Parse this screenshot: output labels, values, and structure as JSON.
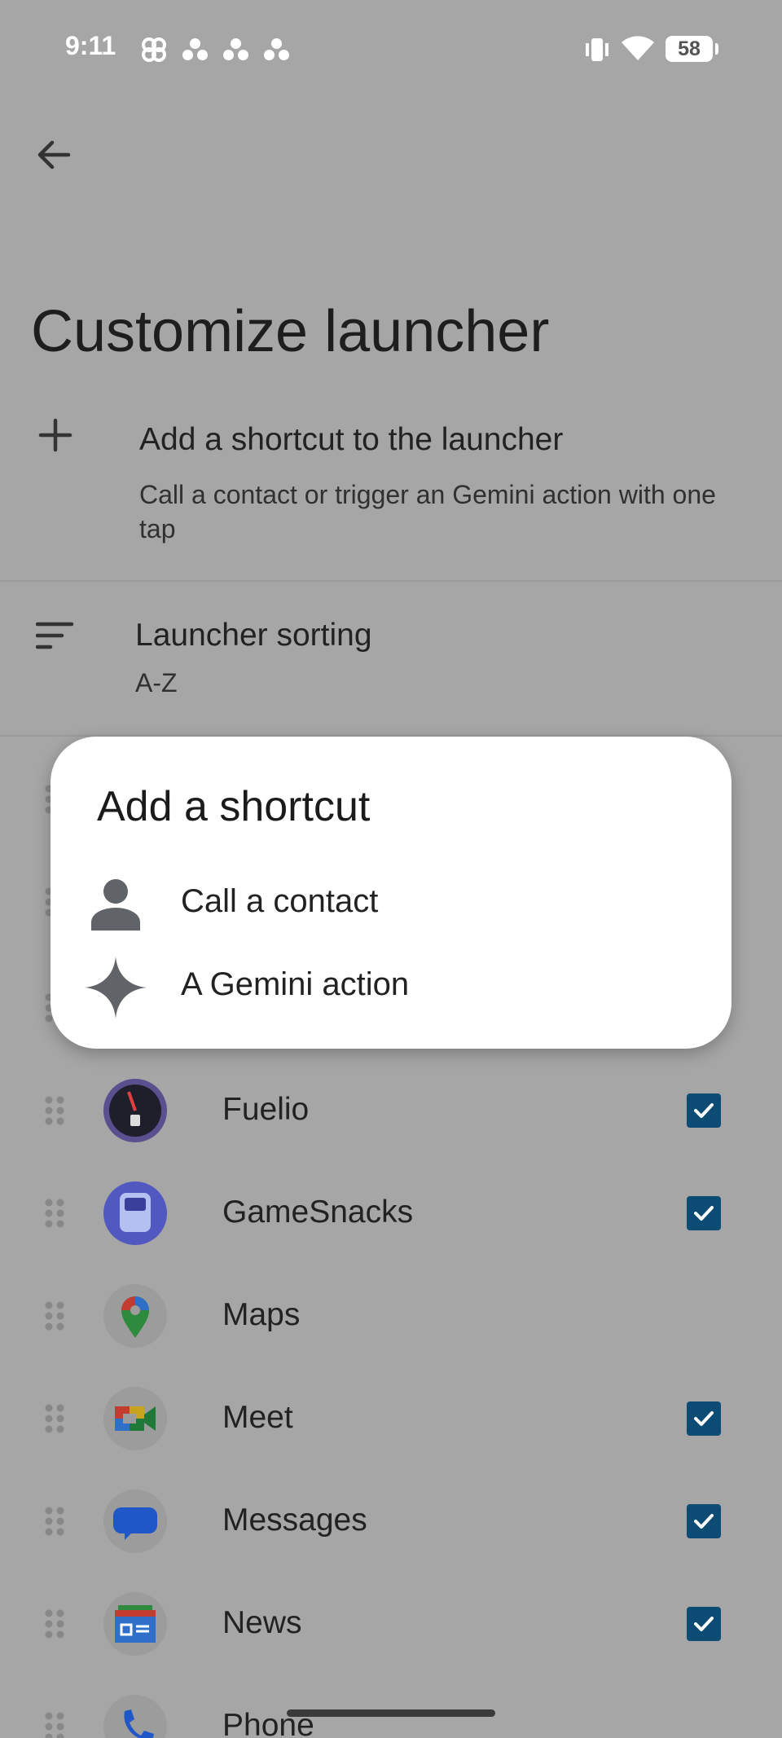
{
  "status_bar": {
    "time": "9:11",
    "battery": "58"
  },
  "page": {
    "title": "Customize launcher",
    "add_shortcut": {
      "title": "Add a shortcut to the launcher",
      "subtitle": "Call a contact or trigger an Gemini action with one tap"
    },
    "sorting": {
      "title": "Launcher sorting",
      "value": "A-Z"
    }
  },
  "apps": [
    {
      "name": "Fuelio",
      "checked": true
    },
    {
      "name": "GameSnacks",
      "checked": true
    },
    {
      "name": "Maps",
      "checked": false
    },
    {
      "name": "Meet",
      "checked": true
    },
    {
      "name": "Messages",
      "checked": true
    },
    {
      "name": "News",
      "checked": true
    },
    {
      "name": "Phone",
      "checked": false
    }
  ],
  "dialog": {
    "title": "Add a shortcut",
    "items": [
      {
        "label": "Call a contact",
        "icon": "person-icon"
      },
      {
        "label": "A Gemini action",
        "icon": "gemini-sparkle-icon"
      }
    ]
  },
  "colors": {
    "scrim": "#a6a6a6",
    "checkbox": "#0c4b74",
    "dialog": "#ffffff"
  }
}
